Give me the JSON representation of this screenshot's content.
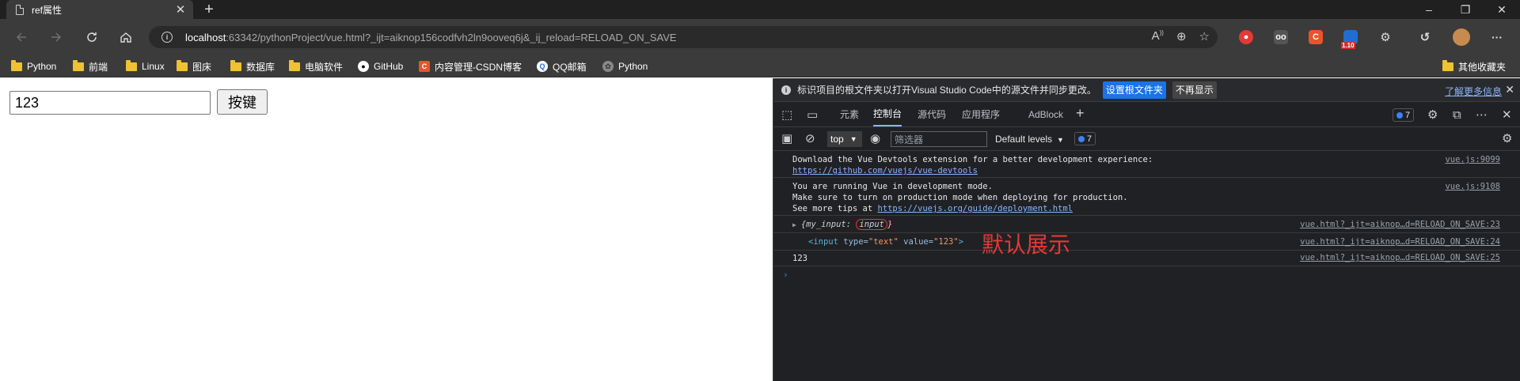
{
  "tab": {
    "title": "ref属性"
  },
  "window": {
    "minimize": "–",
    "maximize": "❐",
    "close": "✕"
  },
  "address": {
    "host": "localhost",
    "rest": ":63342/pythonProject/vue.html?_ijt=aiknop156codfvh2ln9ooveq6j&_ij_reload=RELOAD_ON_SAVE"
  },
  "extensions": {
    "badge_text": "1.10"
  },
  "bookmarks": {
    "items": [
      "Python",
      "前端",
      "Linux",
      "图床",
      "数据库",
      "电脑软件",
      "GitHub",
      "内容管理-CSDN博客",
      "QQ邮箱",
      "Python"
    ],
    "other": "其他收藏夹"
  },
  "page": {
    "input_value": "123",
    "button_label": "按键"
  },
  "devtools": {
    "infobar": {
      "text": "标识项目的根文件夹以打开Visual Studio Code中的源文件并同步更改。",
      "primary": "设置根文件夹",
      "secondary": "不再显示",
      "link": "了解更多信息"
    },
    "tabs": [
      "元素",
      "控制台",
      "源代码",
      "应用程序",
      "AdBlock"
    ],
    "issues_count": "7",
    "context": "top",
    "filter_placeholder": "筛选器",
    "levels": "Default levels",
    "messages_count": "7",
    "logs": {
      "l1a": "Download the Vue Devtools extension for a better development experience:",
      "l1b": "https://github.com/vuejs/vue-devtools",
      "l1src": "vue.js:9099",
      "l2a": "You are running Vue in development mode.",
      "l2b": "Make sure to turn on production mode when deploying for production.",
      "l2c": "See more tips at ",
      "l2link": "https://vuejs.org/guide/deployment.html",
      "l2src": "vue.js:9108",
      "l3key": "{my_input: ",
      "l3val": "input",
      "l3end": "}",
      "l3src": "vue.html?_ijt=aiknop…d=RELOAD_ON_SAVE:23",
      "l4tag": "<input",
      "l4attr1": " type=",
      "l4val1": "\"text\"",
      "l4attr2": " value=",
      "l4val2": "\"123\"",
      "l4end": ">",
      "l4src": "vue.html?_ijt=aiknop…d=RELOAD_ON_SAVE:24",
      "l5": "123",
      "l5src": "vue.html?_ijt=aiknop…d=RELOAD_ON_SAVE:25"
    },
    "annotation": "默认展示"
  }
}
